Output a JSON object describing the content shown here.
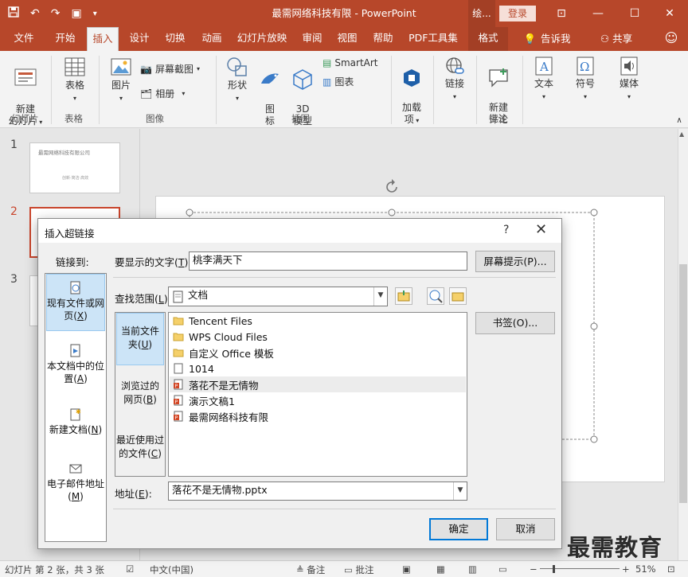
{
  "window": {
    "title": "最需网络科技有限 - PowerPoint",
    "context_tab": "绘...",
    "login": "登录"
  },
  "ribbon_tabs": [
    "文件",
    "开始",
    "插入",
    "设计",
    "切换",
    "动画",
    "幻灯片放映",
    "审阅",
    "视图",
    "帮助",
    "PDF工具集",
    "格式"
  ],
  "tell_me": "告诉我",
  "share": "共享",
  "ribbon": {
    "new_slide": "新建\n幻灯片",
    "table": "表格",
    "picture": "图片",
    "screenshot": "屏幕截图",
    "album": "相册",
    "shapes": "形状",
    "icons": "图\n标",
    "model3d": "3D\n模型",
    "smartart": "SmartArt",
    "chart": "图表",
    "addins": "加载\n项",
    "link": "链接",
    "new_comment": "新建\n评论",
    "text": "文本",
    "symbol": "符号",
    "media": "媒体",
    "groups": {
      "slides": "幻灯片",
      "tables": "表格",
      "images": "图像",
      "illustrations": "插图",
      "comments": "批注"
    }
  },
  "thumbnails": {
    "nums": [
      "1",
      "2",
      "3"
    ],
    "slide1_title": "最需网络科技有限公司",
    "slide1_sub": "创新·简洁·高效"
  },
  "dialog": {
    "title": "插入超链接",
    "help": "?",
    "link_to_label": "链接到:",
    "display_text_label": "要显示的文字(",
    "display_text_key": "T",
    "display_text_value": "桃李满天下",
    "screen_tip": "屏幕提示(P)...",
    "look_in_label": "查找范围(",
    "look_in_key": "L",
    "look_in_value": "文档",
    "bookmark": "书签(O)...",
    "link_targets": [
      {
        "line1": "现有文件或网",
        "line2": "页(",
        "key": "X"
      },
      {
        "line1": "本文档中的位",
        "line2": "置(",
        "key": "A"
      },
      {
        "line1": "新建文档(",
        "line2": "",
        "key": "N"
      },
      {
        "line1": "电子邮件地址",
        "line2": "(",
        "key": "M"
      }
    ],
    "places": [
      {
        "line1": "当前文件",
        "line2": "夹(",
        "key": "U"
      },
      {
        "line1": "浏览过的",
        "line2": "网页(",
        "key": "B"
      },
      {
        "line1": "最近使用过",
        "line2": "的文件(",
        "key": "C"
      }
    ],
    "files": [
      {
        "name": "Tencent Files",
        "type": "folder"
      },
      {
        "name": "WPS Cloud Files",
        "type": "folder"
      },
      {
        "name": "自定义 Office 模板",
        "type": "folder"
      },
      {
        "name": "1014",
        "type": "file"
      },
      {
        "name": "落花不是无情物",
        "type": "ppt"
      },
      {
        "name": "演示文稿1",
        "type": "ppt"
      },
      {
        "name": "最需网络科技有限",
        "type": "ppt"
      }
    ],
    "address_label": "地址(",
    "address_key": "E",
    "address_value": "落花不是无情物.pptx",
    "ok": "确定",
    "cancel": "取消"
  },
  "statusbar": {
    "slide_info": "幻灯片 第 2 张，共 3 张",
    "language": "中文(中国)",
    "notes": "备注",
    "comments": "批注",
    "zoom": "51%"
  },
  "watermark": "最需教育",
  "colors": {
    "accent": "#b7472a",
    "selection": "#cce4f7",
    "default_button_border": "#0078d7"
  }
}
